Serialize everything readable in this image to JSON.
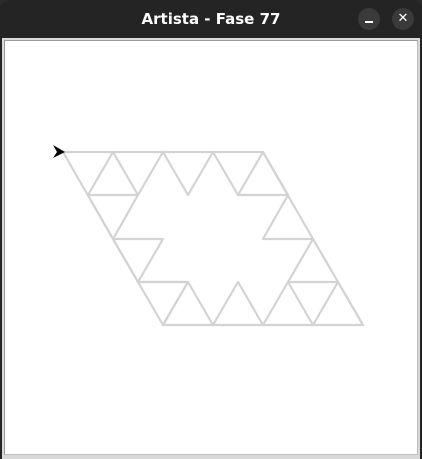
{
  "window": {
    "title": "Artista - Fase 77",
    "minimize_glyph": "–",
    "close_glyph": "✕"
  },
  "canvas": {
    "background": "#ffffff",
    "line_color": "#d3d3d3",
    "turtle_color": "#000000",
    "turtle_icon": "arrowhead-cursor-icon"
  }
}
